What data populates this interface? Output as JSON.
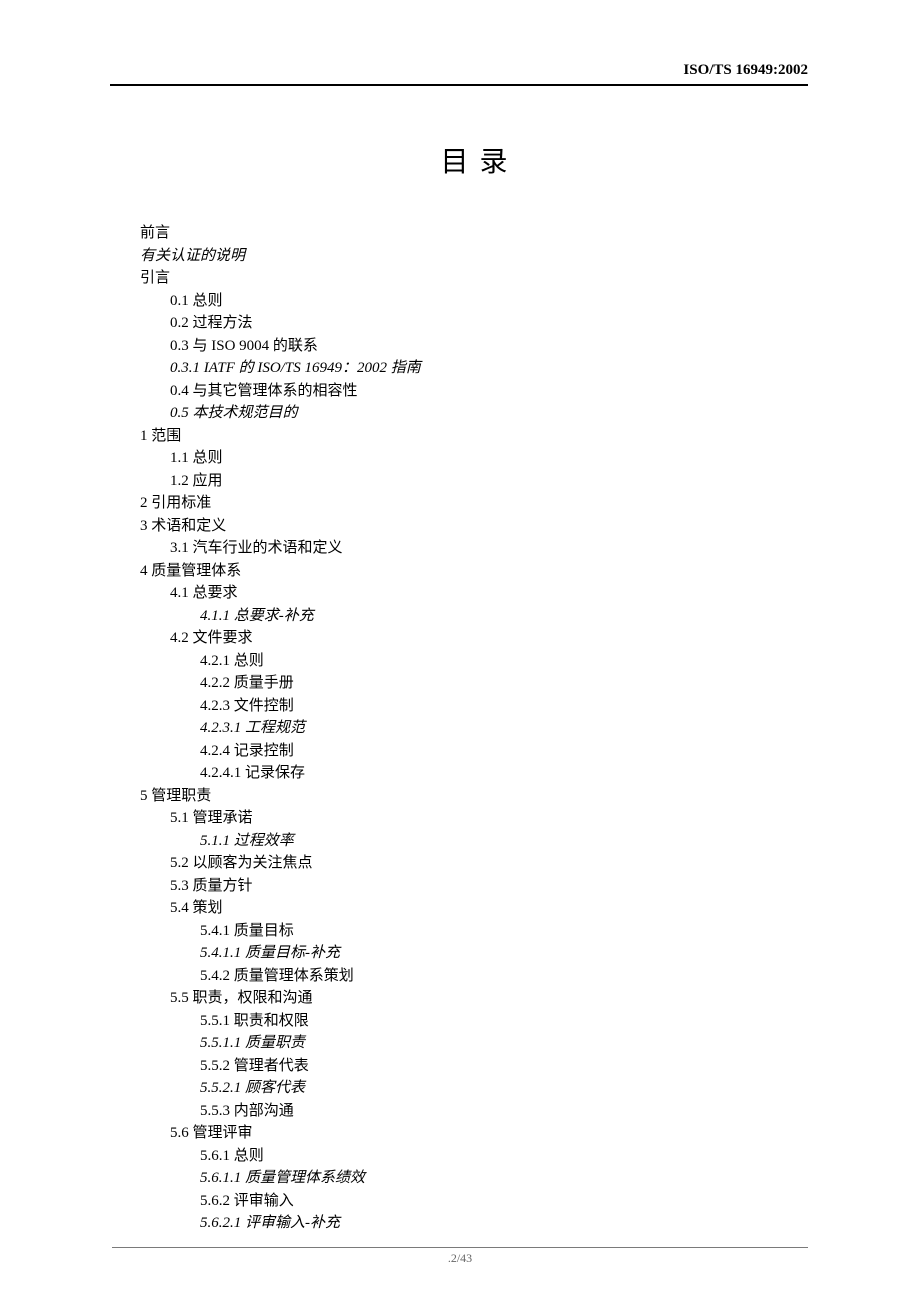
{
  "header": {
    "doc_id": "ISO/TS 16949:2002"
  },
  "title": "目 录",
  "toc": [
    {
      "indent": 0,
      "italic": false,
      "text": "前言"
    },
    {
      "indent": 0,
      "italic": true,
      "text": "有关认证的说明"
    },
    {
      "indent": 0,
      "italic": false,
      "text": "引言"
    },
    {
      "indent": 1,
      "italic": false,
      "text": "0.1 总则"
    },
    {
      "indent": 1,
      "italic": false,
      "text": "0.2 过程方法"
    },
    {
      "indent": 1,
      "italic": false,
      "text": "0.3 与 ISO 9004 的联系"
    },
    {
      "indent": 1,
      "italic": true,
      "text": "0.3.1 IATF 的 ISO/TS 16949：2002 指南"
    },
    {
      "indent": 1,
      "italic": false,
      "text": "0.4 与其它管理体系的相容性"
    },
    {
      "indent": 1,
      "italic": true,
      "text": "0.5 本技术规范目的"
    },
    {
      "indent": 0,
      "italic": false,
      "text": "1 范围"
    },
    {
      "indent": 1,
      "italic": false,
      "text": "1.1 总则"
    },
    {
      "indent": 1,
      "italic": false,
      "text": "1.2 应用"
    },
    {
      "indent": 0,
      "italic": false,
      "text": "2 引用标准"
    },
    {
      "indent": 0,
      "italic": false,
      "text": "3 术语和定义"
    },
    {
      "indent": 1,
      "italic": false,
      "text": "3.1 汽车行业的术语和定义"
    },
    {
      "indent": 0,
      "italic": false,
      "text": "4 质量管理体系"
    },
    {
      "indent": 1,
      "italic": false,
      "text": "4.1 总要求"
    },
    {
      "indent": 2,
      "italic": true,
      "text": "4.1.1 总要求-补充"
    },
    {
      "indent": 1,
      "italic": false,
      "text": "4.2 文件要求"
    },
    {
      "indent": 2,
      "italic": false,
      "text": "4.2.1 总则"
    },
    {
      "indent": 2,
      "italic": false,
      "text": "4.2.2 质量手册"
    },
    {
      "indent": 2,
      "italic": false,
      "text": "4.2.3 文件控制"
    },
    {
      "indent": 2,
      "italic": true,
      "text": "4.2.3.1 工程规范"
    },
    {
      "indent": 2,
      "italic": false,
      "text": "4.2.4 记录控制"
    },
    {
      "indent": 2,
      "italic": false,
      "text": "4.2.4.1 记录保存"
    },
    {
      "indent": 0,
      "italic": false,
      "text": "5 管理职责"
    },
    {
      "indent": 1,
      "italic": false,
      "text": "5.1 管理承诺"
    },
    {
      "indent": 2,
      "italic": true,
      "text": "5.1.1 过程效率"
    },
    {
      "indent": 1,
      "italic": false,
      "text": "5.2 以顾客为关注焦点"
    },
    {
      "indent": 1,
      "italic": false,
      "text": "5.3 质量方针"
    },
    {
      "indent": 1,
      "italic": false,
      "text": "5.4 策划"
    },
    {
      "indent": 2,
      "italic": false,
      "text": "5.4.1 质量目标"
    },
    {
      "indent": 2,
      "italic": true,
      "text": "5.4.1.1 质量目标-补充"
    },
    {
      "indent": 2,
      "italic": false,
      "text": "5.4.2 质量管理体系策划"
    },
    {
      "indent": 1,
      "italic": false,
      "text": "5.5 职责，权限和沟通"
    },
    {
      "indent": 2,
      "italic": false,
      "text": "5.5.1 职责和权限"
    },
    {
      "indent": 2,
      "italic": true,
      "text": "5.5.1.1 质量职责"
    },
    {
      "indent": 2,
      "italic": false,
      "text": "5.5.2 管理者代表"
    },
    {
      "indent": 2,
      "italic": true,
      "text": "5.5.2.1 顾客代表"
    },
    {
      "indent": 2,
      "italic": false,
      "text": "5.5.3 内部沟通"
    },
    {
      "indent": 1,
      "italic": false,
      "text": "5.6 管理评审"
    },
    {
      "indent": 2,
      "italic": false,
      "text": "5.6.1 总则"
    },
    {
      "indent": 2,
      "italic": true,
      "text": "5.6.1.1 质量管理体系绩效"
    },
    {
      "indent": 2,
      "italic": false,
      "text": "5.6.2 评审输入"
    },
    {
      "indent": 2,
      "italic": true,
      "text": "5.6.2.1 评审输入-补充"
    }
  ],
  "footer": {
    "page": ".2/43"
  }
}
